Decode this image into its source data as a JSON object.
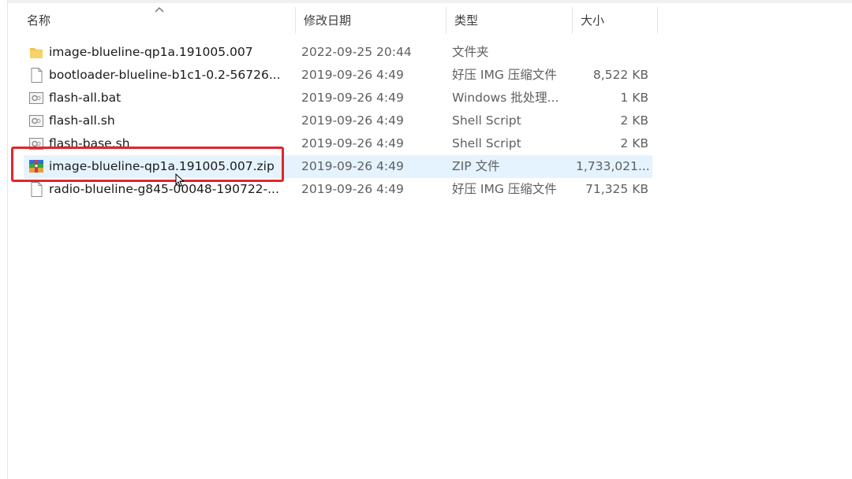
{
  "columns": {
    "name": "名称",
    "date": "修改日期",
    "type": "类型",
    "size": "大小"
  },
  "files": [
    {
      "icon": "folder-icon",
      "name": "image-blueline-qp1a.191005.007",
      "date": "2022-09-25 20:44",
      "type": "文件夹",
      "size": ""
    },
    {
      "icon": "file-icon",
      "name": "bootloader-blueline-b1c1-0.2-56726...",
      "date": "2019-09-26 4:49",
      "type": "好压 IMG 压缩文件",
      "size": "8,522 KB"
    },
    {
      "icon": "script-file-icon",
      "name": "flash-all.bat",
      "date": "2019-09-26 4:49",
      "type": "Windows 批处理...",
      "size": "1 KB"
    },
    {
      "icon": "script-file-icon",
      "name": "flash-all.sh",
      "date": "2019-09-26 4:49",
      "type": "Shell Script",
      "size": "2 KB"
    },
    {
      "icon": "script-file-icon",
      "name": "flash-base.sh",
      "date": "2019-09-26 4:49",
      "type": "Shell Script",
      "size": "2 KB"
    },
    {
      "icon": "zip-archive-icon",
      "name": "image-blueline-qp1a.191005.007.zip",
      "date": "2019-09-26 4:49",
      "type": "ZIP 文件",
      "size": "1,733,021..."
    },
    {
      "icon": "file-icon",
      "name": "radio-blueline-g845-00048-190722-...",
      "date": "2019-09-26 4:49",
      "type": "好压 IMG 压缩文件",
      "size": "71,325 KB"
    }
  ],
  "colors": {
    "hover_row": "#e5f3ff",
    "highlight": "#e0262d",
    "folder": "#f2c14e"
  }
}
